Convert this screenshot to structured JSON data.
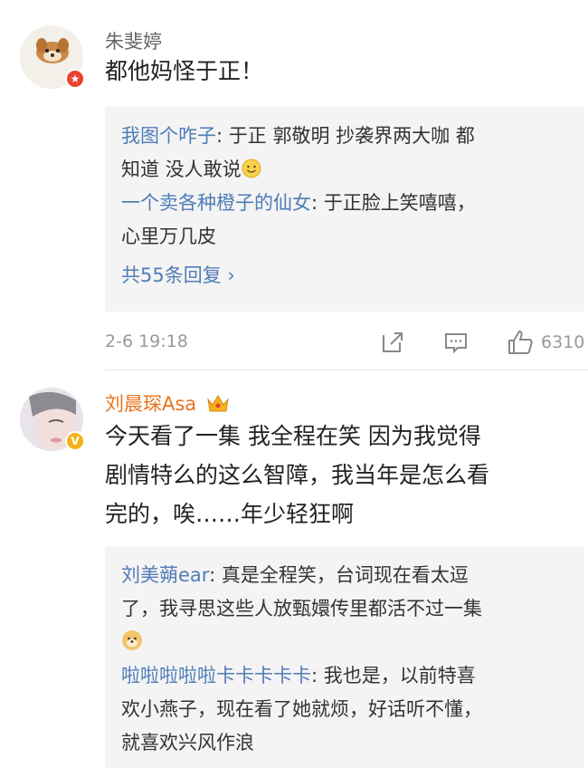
{
  "comments": [
    {
      "username": "朱斐婷",
      "content": "都他妈怪于正！",
      "replies": [
        {
          "name": "我图个咋子",
          "sep": ": ",
          "text_1": "于正 郭敬明 抄袭界两大咖 都",
          "text_2": "知道 没人敢说"
        },
        {
          "name": "一个卖各种橙子的仙女",
          "sep": ": ",
          "text_1": "于正脸上笑嘻嘻，",
          "text_2": "心里万几皮"
        }
      ],
      "more_replies": "共55条回复 ›",
      "time": "2-6 19:18",
      "likes": "6310"
    },
    {
      "username": "刘晨琛Asa",
      "content_lines": [
        "今天看了一集  我全程在笑  因为我觉得",
        "剧情特么的这么智障，我当年是怎么看",
        "完的，唉……年少轻狂啊"
      ],
      "replies": [
        {
          "name": "刘美蒴ear",
          "sep": ": ",
          "text_1": "真是全程笑，台词现在看太逗",
          "text_2": "了，我寻思这些人放甄嬛传里都活不过一集"
        },
        {
          "name": "啦啦啦啦啦卡卡卡卡卡",
          "sep": ": ",
          "text_1": "我也是，以前特喜",
          "text_2": "欢小燕子，现在看了她就烦，好话听不懂，",
          "text_3": "就喜欢兴风作浪"
        }
      ]
    }
  ],
  "colors": {
    "link": "#4f7cb8",
    "vip_name": "#e8731f",
    "reply_bg": "#f4f4f4",
    "meta_gray": "#999999"
  },
  "icons": [
    "share-icon",
    "comment-icon",
    "like-icon",
    "red-star-badge-icon",
    "yellow-v-badge-icon",
    "crown-icon",
    "smile-emoji-icon",
    "dog-emoji-icon"
  ]
}
